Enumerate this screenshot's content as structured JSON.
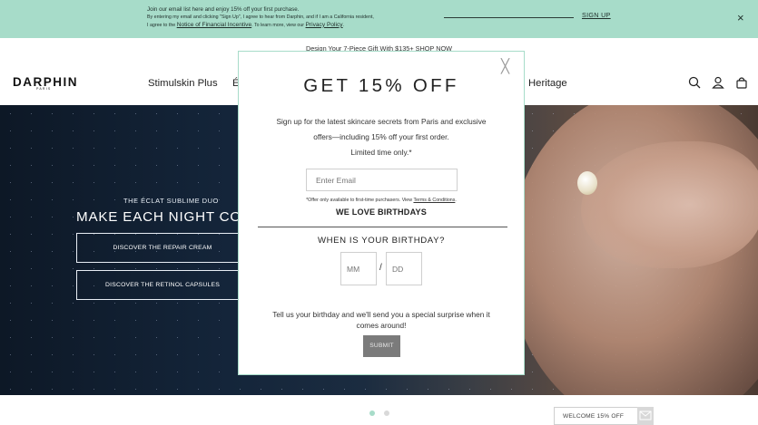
{
  "banner": {
    "line1": "Join our email list here and enjoy 15% off your first purchase.",
    "line2": "By entering my email and clicking \"Sign Up\", I agree to hear from Darphin, and if I am a California resident,",
    "line3_prefix": "I agree to the ",
    "notice_link": "Notice of Financial Incentive",
    "line3_mid": ". To learn more, view our ",
    "privacy_link": "Privacy Policy",
    "line3_end": ".",
    "signup_label": "SIGN UP",
    "close_icon": "×"
  },
  "promo_text": "Design Your 7-Piece Gift With $135+ SHOP NOW",
  "header": {
    "logo": "DARPHIN",
    "logo_sub": "PARIS",
    "nav": [
      "Stimulskin Plus",
      "É",
      "Heritage"
    ],
    "icons": [
      "search-icon",
      "account-icon",
      "bag-icon"
    ]
  },
  "hero": {
    "subtitle": "THE ÉCLAT SUBLIME DUO",
    "title": "MAKE EACH NIGHT CO",
    "buttons": [
      "DISCOVER THE REPAIR CREAM",
      "DISCOVER THE RETINOL CAPSULES"
    ]
  },
  "carousel": {
    "dot_colors": [
      "#a7dcc9",
      "#d9d9d9"
    ]
  },
  "welcome_tab": {
    "label": "WELCOME 15% OFF",
    "icon": "mail-icon"
  },
  "modal": {
    "close_icon": "╳",
    "title": "GET 15% OFF",
    "body1": "Sign up for the latest skincare secrets from Paris and exclusive",
    "body2": "offers—including 15% off your first order.",
    "body3": "Limited time only.*",
    "email_placeholder": "Enter Email",
    "fine_prefix": "*Offer only available to first-time purchasers. View ",
    "fine_link": "Terms & Conditions",
    "fine_end": ".",
    "birthday_heading": "WE LOVE BIRTHDAYS",
    "when_label": "WHEN IS YOUR BIRTHDAY?",
    "mm_placeholder": "MM",
    "separator": "/",
    "dd_placeholder": "DD",
    "bday_text1": "Tell us your birthday and we'll send you a special surprise when it",
    "bday_text2": "comes around!",
    "submit_label": "SUBMIT"
  },
  "colors": {
    "accent": "#a7dcc9",
    "submit": "#7b7b7b"
  }
}
